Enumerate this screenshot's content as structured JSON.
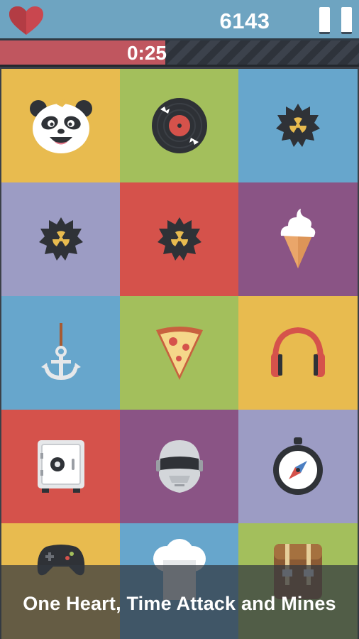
{
  "header": {
    "score": "6143",
    "lives_icon": "heart-icon",
    "pause_icon": "pause-icon"
  },
  "timer": {
    "text": "0:25",
    "remaining_fraction": 0.46
  },
  "grid": {
    "tiles": [
      {
        "icon": "panda-icon",
        "color": "#e8bb4f"
      },
      {
        "icon": "vinyl-record-icon",
        "color": "#a3bf5c"
      },
      {
        "icon": "mine-icon",
        "color": "#67a6cc"
      },
      {
        "icon": "mine-icon",
        "color": "#9c9cc4"
      },
      {
        "icon": "mine-icon",
        "color": "#d5524b"
      },
      {
        "icon": "ice-cream-icon",
        "color": "#8a5485"
      },
      {
        "icon": "anchor-icon",
        "color": "#67a6cc"
      },
      {
        "icon": "pizza-slice-icon",
        "color": "#a3bf5c"
      },
      {
        "icon": "headphones-icon",
        "color": "#e8bb4f"
      },
      {
        "icon": "safe-icon",
        "color": "#d5524b"
      },
      {
        "icon": "robot-helmet-icon",
        "color": "#8a5485"
      },
      {
        "icon": "compass-icon",
        "color": "#9c9cc4"
      },
      {
        "icon": "game-controller-icon",
        "color": "#e8bb4f"
      },
      {
        "icon": "chef-hat-icon",
        "color": "#67a6cc"
      },
      {
        "icon": "backpack-icon",
        "color": "#a3bf5c"
      }
    ]
  },
  "caption": {
    "text": "One Heart, Time Attack and Mines"
  },
  "colors": {
    "topbar": "#6ea4c1",
    "heart": "#c9474f",
    "timer_fill": "#c0565f"
  }
}
